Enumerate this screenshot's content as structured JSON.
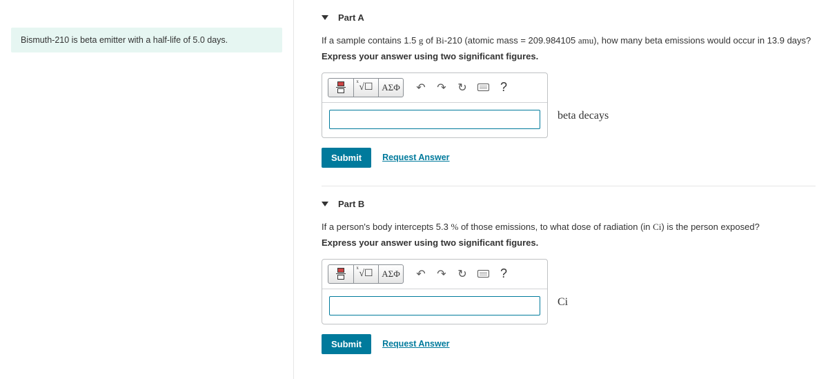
{
  "prompt": "Bismuth-210 is beta emitter with a half-life of 5.0 days.",
  "partA": {
    "label": "Part A",
    "question_pre": "If a sample contains 1.5 ",
    "g": "g",
    "question_mid": " of ",
    "bi": "Bi",
    "question_mid2": "-210 (atomic mass = 209.984105 ",
    "amu": "amu",
    "question_post": "), how many beta emissions would occur in 13.9 days?",
    "instruction": "Express your answer using two significant figures.",
    "greek": "ΑΣΦ",
    "help": "?",
    "unit": "beta decays",
    "submit": "Submit",
    "request": "Request Answer"
  },
  "partB": {
    "label": "Part B",
    "question_pre": "If a person's body intercepts 5.3 ",
    "pct": "%",
    "question_mid": " of those emissions, to what dose of radiation (in ",
    "ci": "Ci",
    "question_post": ") is the person exposed?",
    "instruction": "Express your answer using two significant figures.",
    "greek": "ΑΣΦ",
    "help": "?",
    "unit": "Ci",
    "submit": "Submit",
    "request": "Request Answer"
  }
}
